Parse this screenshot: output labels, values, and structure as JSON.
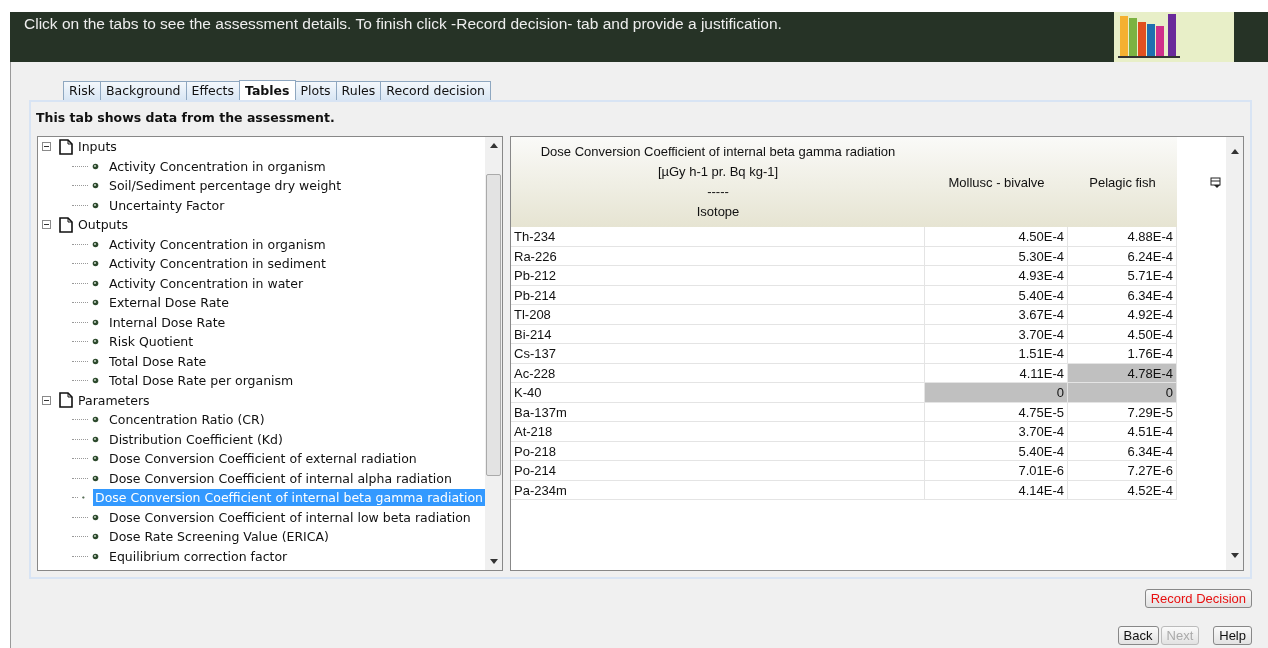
{
  "banner": {
    "text": "Click on the tabs to see the assessment details. To finish click -Record decision- tab and provide a justification."
  },
  "tabs": [
    {
      "label": "Risk",
      "selected": false
    },
    {
      "label": "Background",
      "selected": false
    },
    {
      "label": "Effects",
      "selected": false
    },
    {
      "label": "Tables",
      "selected": true
    },
    {
      "label": "Plots",
      "selected": false
    },
    {
      "label": "Rules",
      "selected": false
    },
    {
      "label": "Record decision",
      "selected": false
    }
  ],
  "caption": "This tab shows data from the assessment.",
  "tree": [
    {
      "label": "Inputs",
      "expanded": true,
      "children": [
        {
          "label": "Activity Concentration in organism",
          "selected": false
        },
        {
          "label": "Soil/Sediment percentage dry weight",
          "selected": false
        },
        {
          "label": "Uncertainty Factor",
          "selected": false
        }
      ]
    },
    {
      "label": "Outputs",
      "expanded": true,
      "children": [
        {
          "label": "Activity Concentration in organism",
          "selected": false
        },
        {
          "label": "Activity Concentration in sediment",
          "selected": false
        },
        {
          "label": "Activity Concentration in water",
          "selected": false
        },
        {
          "label": "External Dose Rate",
          "selected": false
        },
        {
          "label": "Internal Dose Rate",
          "selected": false
        },
        {
          "label": "Risk Quotient",
          "selected": false
        },
        {
          "label": "Total Dose Rate",
          "selected": false
        },
        {
          "label": "Total Dose Rate per organism",
          "selected": false
        }
      ]
    },
    {
      "label": "Parameters",
      "expanded": true,
      "children": [
        {
          "label": "Concentration Ratio (CR)",
          "selected": false
        },
        {
          "label": "Distribution Coefficient (Kd)",
          "selected": false
        },
        {
          "label": "Dose Conversion Coefficient of external radiation",
          "selected": false
        },
        {
          "label": "Dose Conversion Coefficient of internal alpha radiation",
          "selected": false
        },
        {
          "label": "Dose Conversion Coefficient of internal beta gamma radiation",
          "selected": true
        },
        {
          "label": "Dose Conversion Coefficient of internal low beta radiation",
          "selected": false
        },
        {
          "label": "Dose Rate Screening Value (ERICA)",
          "selected": false
        },
        {
          "label": "Equilibrium correction factor",
          "selected": false
        }
      ]
    }
  ],
  "table": {
    "header_lines": [
      "Dose Conversion Coefficient of internal beta gamma radiation",
      "[µGy h-1 pr. Bq kg-1]",
      "-----",
      "Isotope"
    ],
    "columns": [
      "Mollusc - bivalve",
      "Pelagic fish"
    ],
    "rows": [
      {
        "isotope": "Th-234",
        "cells": [
          {
            "text": "4.50E-4",
            "selected": false
          },
          {
            "text": "4.88E-4",
            "selected": false
          }
        ]
      },
      {
        "isotope": "Ra-226",
        "cells": [
          {
            "text": "5.30E-4",
            "selected": false
          },
          {
            "text": "6.24E-4",
            "selected": false
          }
        ]
      },
      {
        "isotope": "Pb-212",
        "cells": [
          {
            "text": "4.93E-4",
            "selected": false
          },
          {
            "text": "5.71E-4",
            "selected": false
          }
        ]
      },
      {
        "isotope": "Pb-214",
        "cells": [
          {
            "text": "5.40E-4",
            "selected": false
          },
          {
            "text": "6.34E-4",
            "selected": false
          }
        ]
      },
      {
        "isotope": "Tl-208",
        "cells": [
          {
            "text": "3.67E-4",
            "selected": false
          },
          {
            "text": "4.92E-4",
            "selected": false
          }
        ]
      },
      {
        "isotope": "Bi-214",
        "cells": [
          {
            "text": "3.70E-4",
            "selected": false
          },
          {
            "text": "4.50E-4",
            "selected": false
          }
        ]
      },
      {
        "isotope": "Cs-137",
        "cells": [
          {
            "text": "1.51E-4",
            "selected": false
          },
          {
            "text": "1.76E-4",
            "selected": false
          }
        ]
      },
      {
        "isotope": "Ac-228",
        "cells": [
          {
            "text": "4.11E-4",
            "selected": false
          },
          {
            "text": "4.78E-4",
            "selected": true
          }
        ]
      },
      {
        "isotope": "K-40",
        "cells": [
          {
            "text": "0",
            "selected": true
          },
          {
            "text": "0",
            "selected": true
          }
        ]
      },
      {
        "isotope": "Ba-137m",
        "cells": [
          {
            "text": "4.75E-5",
            "selected": false
          },
          {
            "text": "7.29E-5",
            "selected": false
          }
        ]
      },
      {
        "isotope": "At-218",
        "cells": [
          {
            "text": "3.70E-4",
            "selected": false
          },
          {
            "text": "4.51E-4",
            "selected": false
          }
        ]
      },
      {
        "isotope": "Po-218",
        "cells": [
          {
            "text": "5.40E-4",
            "selected": false
          },
          {
            "text": "6.34E-4",
            "selected": false
          }
        ]
      },
      {
        "isotope": "Po-214",
        "cells": [
          {
            "text": "7.01E-6",
            "selected": false
          },
          {
            "text": "7.27E-6",
            "selected": false
          }
        ]
      },
      {
        "isotope": "Pa-234m",
        "cells": [
          {
            "text": "4.14E-4",
            "selected": false
          },
          {
            "text": "4.52E-4",
            "selected": false
          }
        ]
      }
    ]
  },
  "buttons": [
    {
      "label": "Record Decision",
      "kind": "record",
      "disabled": false
    },
    {
      "label": "Back",
      "kind": "nav",
      "disabled": false
    },
    {
      "label": "Next",
      "kind": "nav",
      "disabled": true
    },
    {
      "label": "Help",
      "kind": "help",
      "disabled": false
    }
  ]
}
